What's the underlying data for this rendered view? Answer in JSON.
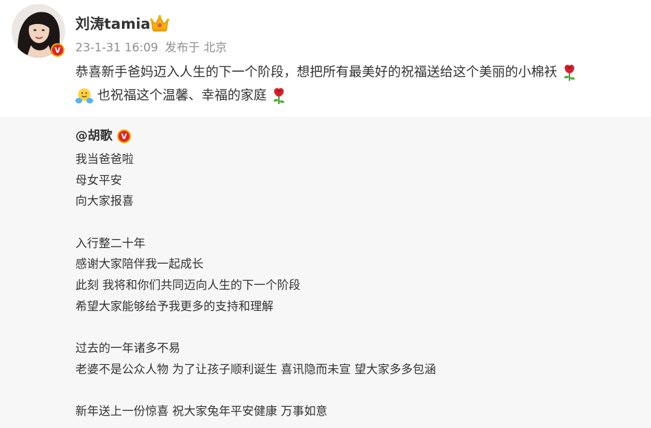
{
  "post": {
    "author": "刘涛tamia",
    "date": "23-1-31 16:09",
    "source": "发布于 北京",
    "text_line1": "恭喜新手爸妈迈入人生的下一个阶段，想把所有最美好的祝福送给这个美丽的小棉袄",
    "text_line2": "也祝福这个温馨、幸福的家庭",
    "badge_letter": "V"
  },
  "quoted": {
    "author": "@胡歌",
    "badge_letter": "V",
    "lines": [
      "我当爸爸啦",
      "母女平安",
      "向大家报喜",
      "",
      "入行整二十年",
      "感谢大家陪伴我一起成长",
      "此刻 我将和你们共同迈向人生的下一个阶段",
      "希望大家能够给予我更多的支持和理解",
      "",
      "过去的一年诸多不易",
      "老婆不是公众人物 为了让孩子顺利诞生 喜讯隐而未宣 望大家多多包涵",
      "",
      "新年送上一份惊喜 祝大家兔年平安健康 万事如意"
    ]
  },
  "icons": {
    "avatar": "avatar",
    "verified_badge": "verified-badge-icon",
    "crown": "crown-icon",
    "rose": "rose-icon",
    "hug": "hug-emoji-icon"
  },
  "colors": {
    "text": "#333333",
    "meta": "#8f8f8f",
    "quoted_bg": "#f7f7f7",
    "badge_red": "#e02424",
    "badge_gold": "#f7a900"
  }
}
